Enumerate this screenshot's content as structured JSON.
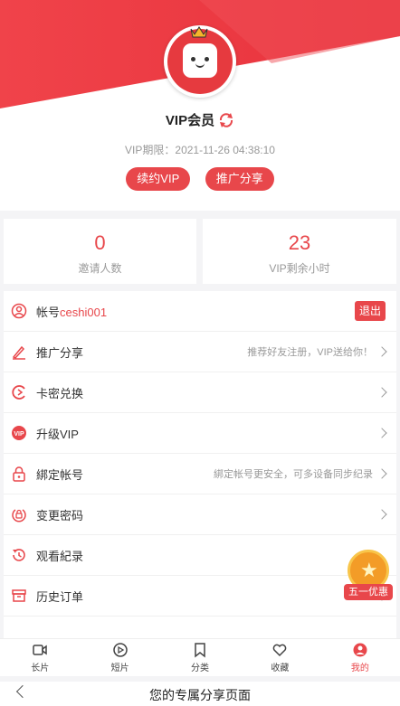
{
  "header": {
    "title": "VIP会员",
    "expiry": "VIP期限：2021-11-26 04:38:10",
    "renew_label": "续约VIP",
    "share_label": "推广分享"
  },
  "stats": {
    "invites_value": "0",
    "invites_label": "邀请人数",
    "hours_value": "23",
    "hours_label": "VIP剩余小时"
  },
  "menu": {
    "account_prefix": "帐号",
    "account_name": "ceshi001",
    "logout_label": "退出",
    "items": [
      {
        "label": "推广分享",
        "hint": "推荐好友注册，VIP送给你！",
        "icon": "pen-icon"
      },
      {
        "label": "卡密兑换",
        "hint": "",
        "icon": "card-icon"
      },
      {
        "label": "升级VIP",
        "hint": "",
        "icon": "vip-icon"
      },
      {
        "label": "綁定帐号",
        "hint": "綁定帐号更安全，可多设备同步纪录",
        "icon": "lock-icon"
      },
      {
        "label": "变更密码",
        "hint": "",
        "icon": "password-icon"
      },
      {
        "label": "观看紀录",
        "hint": "",
        "icon": "history-icon"
      },
      {
        "label": "历史订单",
        "hint": "",
        "icon": "order-icon"
      }
    ]
  },
  "badge": {
    "label": "五一优惠"
  },
  "tabs": [
    {
      "label": "长片",
      "icon": "video-icon"
    },
    {
      "label": "短片",
      "icon": "play-icon"
    },
    {
      "label": "分类",
      "icon": "bookmark-icon"
    },
    {
      "label": "收藏",
      "icon": "heart-icon"
    },
    {
      "label": "我的",
      "icon": "user-icon",
      "active": true
    }
  ],
  "bottom": {
    "title": "您的专属分享页面"
  },
  "colors": {
    "accent": "#e8474b",
    "banner": "#e63a3f"
  }
}
